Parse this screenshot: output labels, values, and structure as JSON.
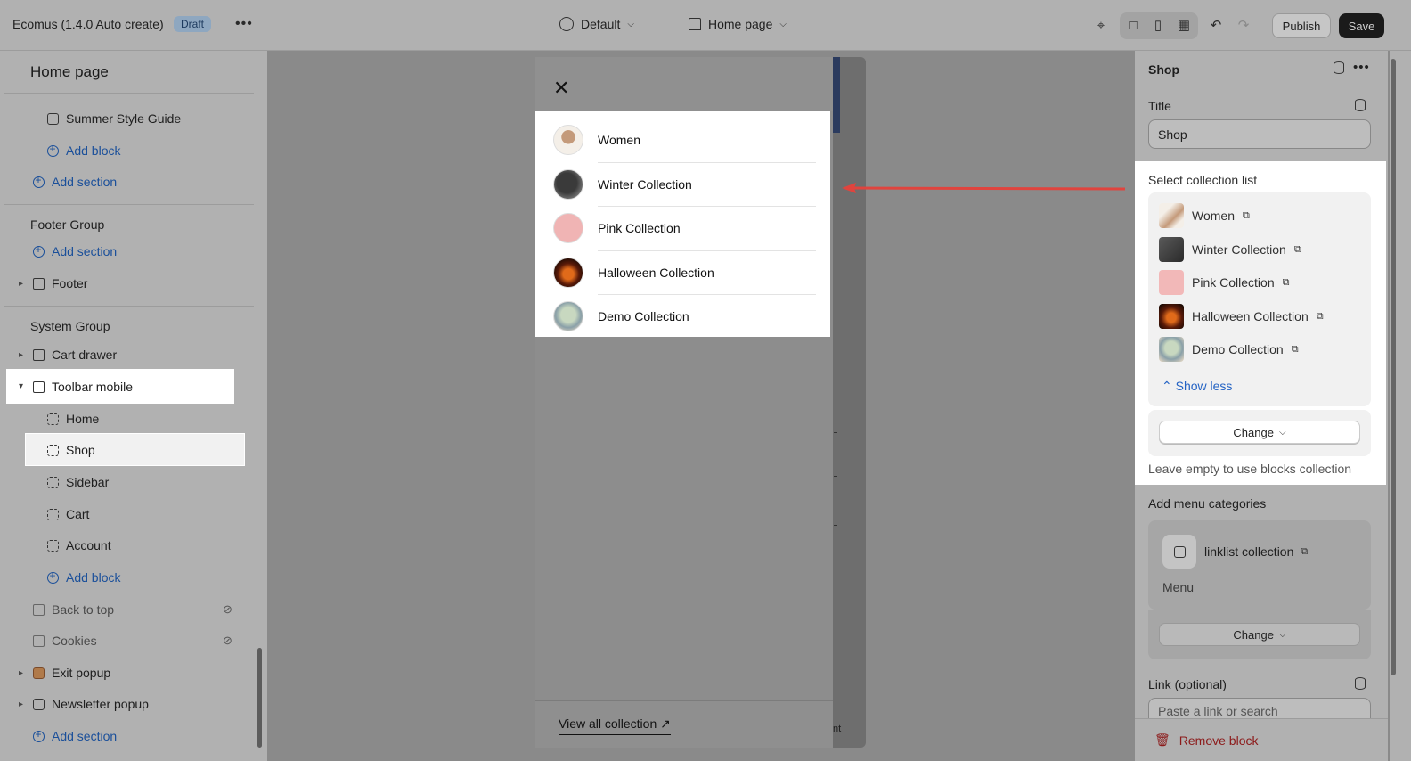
{
  "topbar": {
    "app_title": "Ecomus (1.4.0 Auto create)",
    "status_badge": "Draft",
    "theme_selector": "Default",
    "page_selector": "Home page",
    "publish_label": "Publish",
    "save_label": "Save"
  },
  "left_sidebar": {
    "heading": "Home page",
    "items": {
      "summer_style_guide": "Summer Style Guide",
      "add_block_1": "Add block",
      "add_section_1": "Add section",
      "footer_group": "Footer Group",
      "add_section_2": "Add section",
      "footer": "Footer",
      "system_group": "System Group",
      "cart_drawer": "Cart drawer",
      "toolbar_mobile": "Toolbar mobile",
      "home": "Home",
      "shop": "Shop",
      "sidebar": "Sidebar",
      "cart": "Cart",
      "account": "Account",
      "add_block_2": "Add block",
      "back_to_top": "Back to top",
      "cookies": "Cookies",
      "exit_popup": "Exit popup",
      "newsletter_popup": "Newsletter popup",
      "add_section_3": "Add section"
    }
  },
  "preview": {
    "collections": [
      "Women",
      "Winter Collection",
      "Pink Collection",
      "Halloween Collection",
      "Demo Collection"
    ],
    "view_all": "View all collection",
    "edge_text": "nt"
  },
  "right_sidebar": {
    "block_title": "Shop",
    "title_label": "Title",
    "title_value": "Shop",
    "select_label": "Select collection list",
    "collections": [
      "Women",
      "Winter Collection",
      "Pink Collection",
      "Halloween Collection",
      "Demo Collection"
    ],
    "show_less": "Show less",
    "change_label": "Change",
    "hint": "Leave empty to use blocks collection",
    "menu_label": "Add menu categories",
    "menu_name": "linklist collection",
    "menu_sub": "Menu",
    "menu_change": "Change",
    "link_label": "Link (optional)",
    "link_placeholder": "Paste a link or search",
    "remove_block": "Remove block"
  },
  "colors": {
    "accent_link": "#2463c4",
    "danger": "#8c1a1a",
    "annotation_arrow": "#e0443e"
  }
}
